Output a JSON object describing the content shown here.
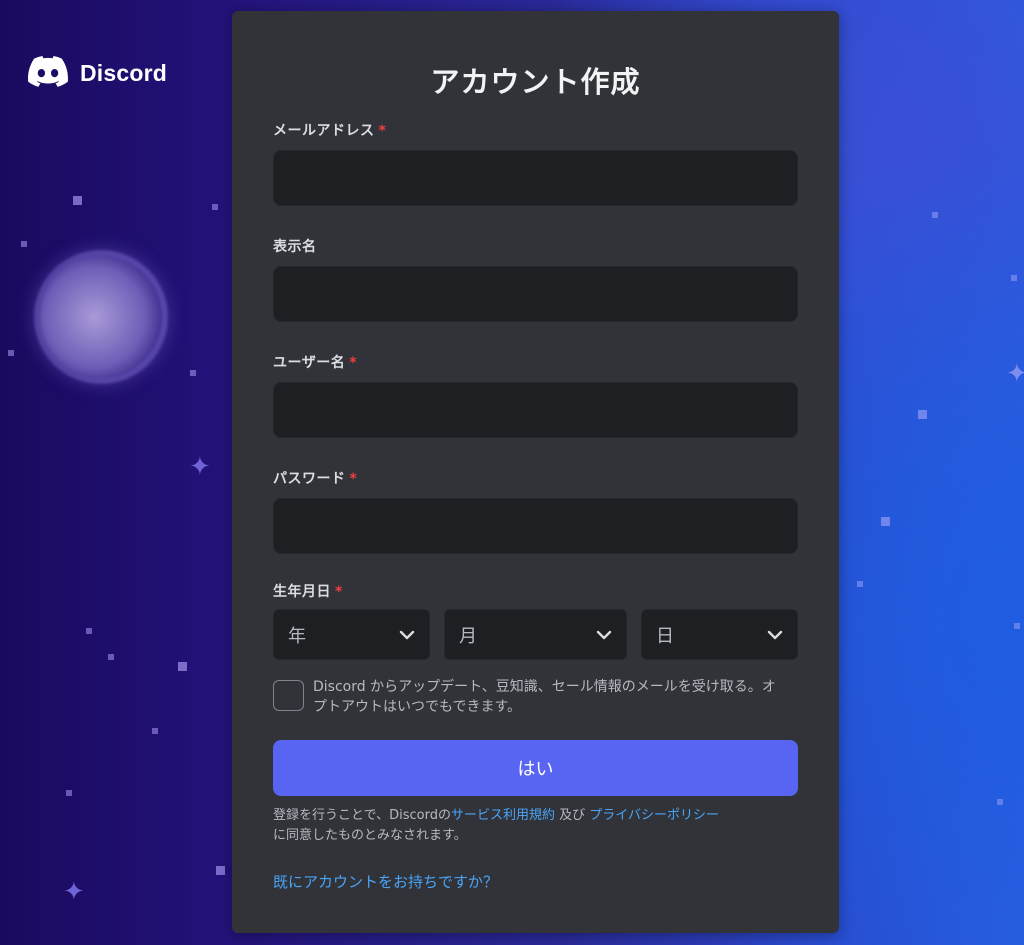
{
  "brand": {
    "name": "Discord",
    "logo_icon": "discord-logo-icon"
  },
  "form": {
    "title": "アカウント作成",
    "email": {
      "label": "メールアドレス",
      "required": "*",
      "value": ""
    },
    "display_name": {
      "label": "表示名",
      "value": ""
    },
    "username": {
      "label": "ユーザー名",
      "required": "*",
      "value": ""
    },
    "password": {
      "label": "パスワード",
      "required": "*",
      "value": ""
    },
    "birthdate": {
      "label": "生年月日",
      "required": "*",
      "year_placeholder": "年",
      "month_placeholder": "月",
      "day_placeholder": "日"
    },
    "marketing_optin": {
      "checked": false,
      "text": "Discord からアップデート、豆知識、セール情報のメールを受け取る。オプトアウトはいつでもできます。"
    },
    "submit_label": "はい",
    "legal": {
      "prefix": "登録を行うことで、Discordの",
      "tos_link": "サービス利用規約",
      "conjunction": " 及び ",
      "privacy_link": "プライバシーポリシー",
      "suffix": "に同意したものとみなされます。"
    },
    "login_link": "既にアカウントをお持ちですか？"
  },
  "colors": {
    "card_bg": "#313338",
    "input_bg": "#1e1f22",
    "primary_button": "#5865f2",
    "link": "#4aa4f7",
    "required": "#f23f42"
  }
}
